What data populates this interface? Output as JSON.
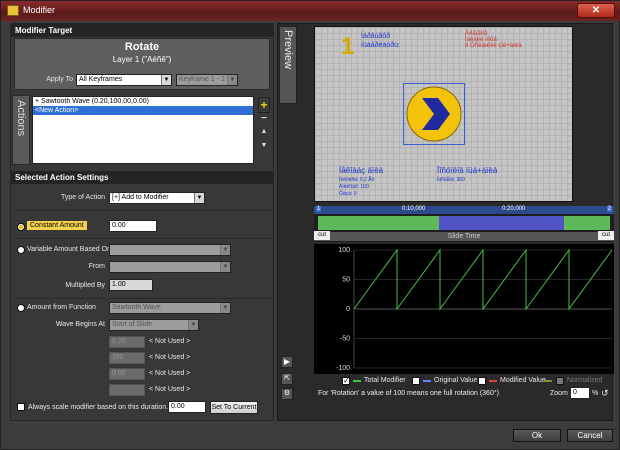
{
  "window": {
    "title": "Modifier",
    "close": "✕"
  },
  "modifier_target": {
    "heading": "Modifier Target",
    "name": "Rotate",
    "layer": "Layer 1 (\"Aéñê\")",
    "apply_to_label": "Apply To",
    "apply_to_value": "All Keyframes",
    "keyframe_value": "Keyframe 1 - 2"
  },
  "actions": {
    "tab_label": "Actions",
    "items": [
      "+ Sawtooth Wave (0.20,100.00,0.00)",
      "<New Action>"
    ],
    "add": "+",
    "remove": "−",
    "up": "▲",
    "down": "▼"
  },
  "selected_action": {
    "heading": "Selected Action Settings",
    "type_label": "Type of Action",
    "type_value": "[+] Add to Modifier",
    "constant_label": "Constant Amount",
    "constant_value": "0.00",
    "variable_label": "Variable Amount Based On",
    "from_label": "From",
    "multiplied_label": "Multiplied By",
    "multiplied_value": "1.00",
    "function_label": "Amount from Function",
    "function_value": "Sawtooth Wave",
    "wave_label": "Wave Begins At",
    "wave_value": "Start of Slide",
    "params": [
      {
        "value": "0.20",
        "label": "< Not Used >"
      },
      {
        "value": "100",
        "label": "< Not Used >"
      },
      {
        "value": "0.00",
        "label": "< Not Used >"
      },
      {
        "value": "",
        "label": "< Not Used >"
      }
    ],
    "scale_label": "Always scale modifier based on this duration.",
    "scale_value": "0.00",
    "set_current": "Set To Current"
  },
  "preview": {
    "tab_label": "Preview",
    "slide": {
      "number": "1",
      "line1": "Íáðãúãôð",
      "line2": "Íüàåðèàóðü:",
      "red_lines": [
        "Âðãìãïíå",
        "Ìàêàëè ïéôá",
        "ë Ôñëæêéè çïé+àíéá"
      ],
      "bottom_left_title": "Íåêîàáç áïèà",
      "bottom_left_rows": [
        "Íéëòëñá: 0.2 Ãö",
        "Àìëèîïáïï: 100",
        "Ôàçà: 0"
      ],
      "bottom_right_title": "Ïîñóïéïä ïüá+àïèà",
      "bottom_right_rows": [
        "Ïüñàåïá: 360"
      ]
    },
    "timeline": {
      "start_num": "1",
      "end_num": "2",
      "time1": "0:10,000",
      "time2": "0:20,000",
      "label": "Slide Time",
      "cut": "cut"
    }
  },
  "chart_data": {
    "type": "line",
    "title": "",
    "xlabel": "",
    "ylabel": "",
    "ylim": [
      -100,
      100
    ],
    "yticks": [
      100,
      50,
      0,
      -50,
      -100
    ],
    "grid": true,
    "series": [
      {
        "name": "Total Modifier",
        "color": "#46c040",
        "pattern": "sawtooth",
        "period_count": 6,
        "min": 0,
        "max": 100
      }
    ]
  },
  "legend": {
    "items": [
      {
        "label": "Total Modifier",
        "checked": true,
        "color": "#46c040"
      },
      {
        "label": "Original Value",
        "checked": false,
        "color": "#6080ff"
      },
      {
        "label": "Modified Value",
        "checked": false,
        "color": "#e04040"
      },
      {
        "label": "Normalized",
        "checked": false,
        "color": "#8c8c3c"
      }
    ]
  },
  "note": "For 'Rotation' a value of 100 means one full rotation (360°)",
  "zoom": {
    "label": "Zoom",
    "value": "0",
    "unit": "%"
  },
  "footer": {
    "ok": "Ok",
    "cancel": "Cancel"
  }
}
